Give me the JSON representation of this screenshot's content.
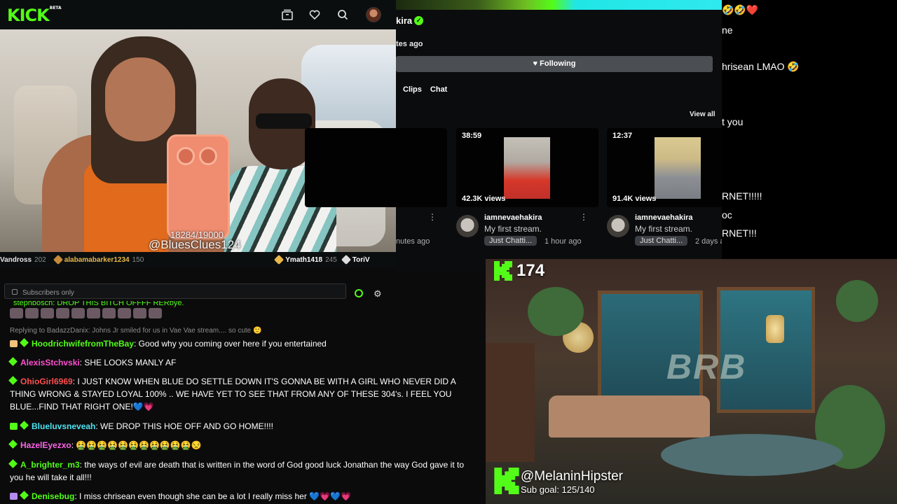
{
  "kick_header": {
    "logo": "KICK",
    "logo_tag": "BETA",
    "icons": [
      "live-channels-icon",
      "heart-icon",
      "search-icon"
    ]
  },
  "video": {
    "counter": "18284/19000",
    "handle": "@BluesClues124"
  },
  "gifters": [
    {
      "name": "Vandross",
      "amount": "202",
      "color": "#e5e5e5"
    },
    {
      "name": "alabamabarker1234",
      "amount": "150",
      "color": "#e9b84a"
    },
    {
      "name": "Ymath1418",
      "amount": "245",
      "color": "#e5e5e5"
    },
    {
      "name": "ToriV",
      "amount": "",
      "color": "#e5e5e5"
    }
  ],
  "chat_input": {
    "placeholder": "Subscribers only"
  },
  "channel": {
    "name": "kira",
    "time": "tes ago",
    "following_label": "Following",
    "tabs": [
      "Clips",
      "Chat"
    ],
    "view_all": "View all",
    "clips": [
      {
        "duration": "",
        "views": "",
        "channel": "",
        "title": "",
        "tag": "",
        "ago": "nutes ago"
      },
      {
        "duration": "38:59",
        "views": "42.3K views",
        "channel": "iamnevaehakira",
        "title": "My first stream.",
        "tag": "Just Chatti...",
        "ago": "1 hour ago"
      },
      {
        "duration": "12:37",
        "views": "91.4K views",
        "channel": "iamnevaehakira",
        "title": "My first stream.",
        "tag": "Just Chatti...",
        "ago": "2 days a"
      }
    ]
  },
  "right_chat": {
    "lines": [
      "🤣🤣❤️",
      "ne",
      "hrisean LMAO 🤣",
      "t you",
      "RNET!!!!!",
      "oc",
      "RNET!!!"
    ]
  },
  "chat": {
    "top_fragment": "stephbosch: DROP THIS BITCH OFFFF RERbye.",
    "reply_note": "Replying to BadazzDanix: Johns Jr smiled for us in Vae Vae stream.... so cute 🙂",
    "messages": [
      {
        "user": "HoodrichwifefromTheBay",
        "color": "#53fc18",
        "text": ": Good why you coming over here if you entertained",
        "gift": "#f1c27a"
      },
      {
        "user": "AlexisStchvski",
        "color": "#ff4fcf",
        "text": ": SHE LOOKS MANLY AF",
        "gift": ""
      },
      {
        "user": "OhioGirl6969",
        "color": "#ff4f4f",
        "text": ": I JUST KNOW WHEN BLUE DO SETTLE DOWN IT'S GONNA BE WITH A GIRL WHO NEVER DID A THING WRONG & STAYED LOYAL 100% .. WE HAVE YET TO SEE THAT FROM ANY OF THESE 304's. I FEEL YOU BLUE...FIND THAT RIGHT ONE!💙💗",
        "gift": ""
      },
      {
        "user": "Blueluvsneveah",
        "color": "#4fe3f0",
        "text": ": WE DROP THIS HOE OFF AND GO HOME!!!!",
        "gift": "#53fc18"
      },
      {
        "user": "HazelEyezxo",
        "color": "#ff63e6",
        "text": ": 🤮🤮🤮🤮🤮🤮🤮🤮🤮🤮🤮😒",
        "gift": ""
      },
      {
        "user": "A_brighter_m3",
        "color": "#53fc18",
        "text": ": the ways of evil are death that is written in the word of God good luck Jonathan the way God gave it to you he will take it all!!!",
        "gift": ""
      },
      {
        "user": "Denisebug",
        "color": "#53fc18",
        "text": ": I miss chrisean even though she can be a lot I really miss her 💙💗💙💗",
        "gift": "#b48cf0"
      }
    ]
  },
  "brb": {
    "viewer_count": "174",
    "scene_text": "BRB",
    "handle": "@MelaninHipster",
    "sub_goal": "Sub goal: 125/140"
  },
  "colors": {
    "kick_green": "#53fc18",
    "panel_bg": "#0b0c0d",
    "following_bg": "#4b4e52"
  }
}
